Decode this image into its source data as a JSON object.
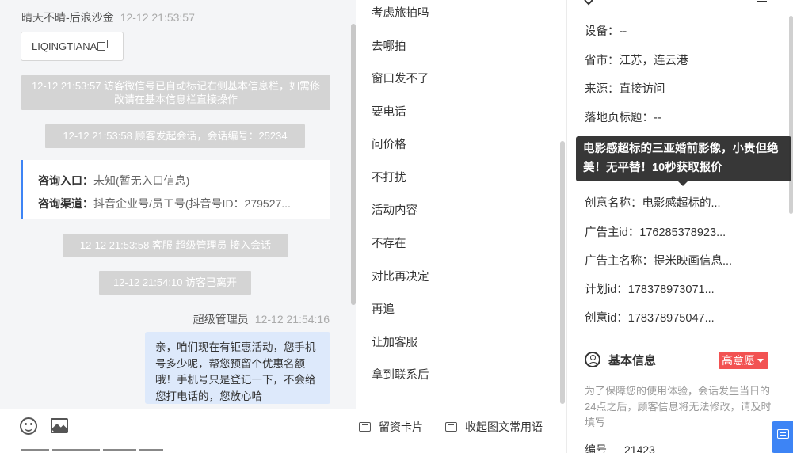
{
  "chat": {
    "visitor_name": "晴天不晴-后浪沙金",
    "visitor_time": "12-12 21:53:57",
    "visitor_code": "LIQINGTIANA",
    "sys_msg_1": "12-12 21:53:57 访客微信号已自动标记右侧基本信息栏，如需修改请在基本信息栏直接操作",
    "sys_msg_2": "12-12 21:53:58 顾客发起会话，会话编号：25234",
    "info_card": {
      "entry_label": "咨询入口：",
      "entry_value": "未知(暂无入口信息)",
      "channel_label": "咨询渠道：",
      "channel_value": "抖音企业号/员工号(抖音号ID：279527..."
    },
    "sys_msg_3": "12-12 21:53:58 客服 超级管理员 接入会话",
    "sys_msg_4": "12-12 21:54:10 访客已离开",
    "agent_name": "超级管理员",
    "agent_time": "12-12 21:54:16",
    "agent_msg": "亲，咱们现在有钜惠活动，您手机号多少呢，帮您预留个优惠名额哦！手机号只是登记一下，不会给您打电话的，您放心哈"
  },
  "toolbar": {
    "emoji_icon": "smile-icon",
    "image_icon": "image-icon",
    "card_label": "留资卡片",
    "phrase_label": "收起图文常用语"
  },
  "phrases": [
    "考虑旅拍吗",
    "去哪拍",
    "窗口发不了",
    "要电话",
    "问价格",
    "不打扰",
    "活动内容",
    "不存在",
    "对比再决定",
    "再追",
    "让加客服",
    "拿到联系后"
  ],
  "right_panel": {
    "fields": [
      {
        "label": "设备：",
        "value": "--"
      },
      {
        "label": "省市：",
        "value": "江苏，连云港"
      },
      {
        "label": "来源：",
        "value": "直接访问"
      },
      {
        "label": "落地页标题：",
        "value": "--"
      },
      {
        "label": "创意名称：",
        "value": "电影感超标的..."
      },
      {
        "label": "广告主id：",
        "value": "176285378923..."
      },
      {
        "label": "广告主名称：",
        "value": "提米映画信息..."
      },
      {
        "label": "计划id：",
        "value": "178378973071..."
      },
      {
        "label": "创意id：",
        "value": "178378975047..."
      }
    ],
    "basic_info_title": "基本信息",
    "intent_label": "高意愿",
    "hint": "为了保障您的使用体验，会话发生当日的24点之后，顾客信息将无法修改，请及时填写",
    "id_label": "编号",
    "id_value": "21423"
  },
  "tooltip": "电影感超标的三亚婚前影像，小贵但绝美！无平替！10秒获取报价",
  "colors": {
    "accent": "#3d84f5",
    "intent_badge": "#f25252",
    "agent_bubble": "#dde9fb",
    "system_msg": "#d4d4d4"
  }
}
